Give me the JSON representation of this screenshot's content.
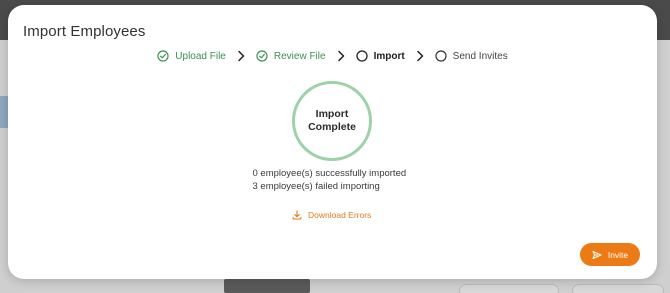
{
  "modal": {
    "title": "Import Employees"
  },
  "stepper": {
    "steps": [
      {
        "label": "Upload File",
        "status": "done",
        "icon": "check-circle-icon"
      },
      {
        "label": "Review File",
        "status": "done",
        "icon": "check-circle-icon"
      },
      {
        "label": "Import",
        "status": "current",
        "icon": "empty-circle-icon"
      },
      {
        "label": "Send Invites",
        "status": "pending",
        "icon": "empty-circle-icon"
      }
    ],
    "separator_icon": "chevron-right-icon"
  },
  "status": {
    "ring_line1": "Import",
    "ring_line2": "Complete"
  },
  "results": {
    "success": "0 employee(s) successfully imported",
    "failed": "3 employee(s) failed importing"
  },
  "download_errors": {
    "label": "Download Errors",
    "icon": "download-icon"
  },
  "invite_button": {
    "label": "Invite",
    "icon": "send-icon"
  },
  "colors": {
    "done_green": "#3f8f52",
    "ring_green": "#9dd1a8",
    "accent_orange": "#ec7b16",
    "link_orange": "#e07d1d"
  }
}
